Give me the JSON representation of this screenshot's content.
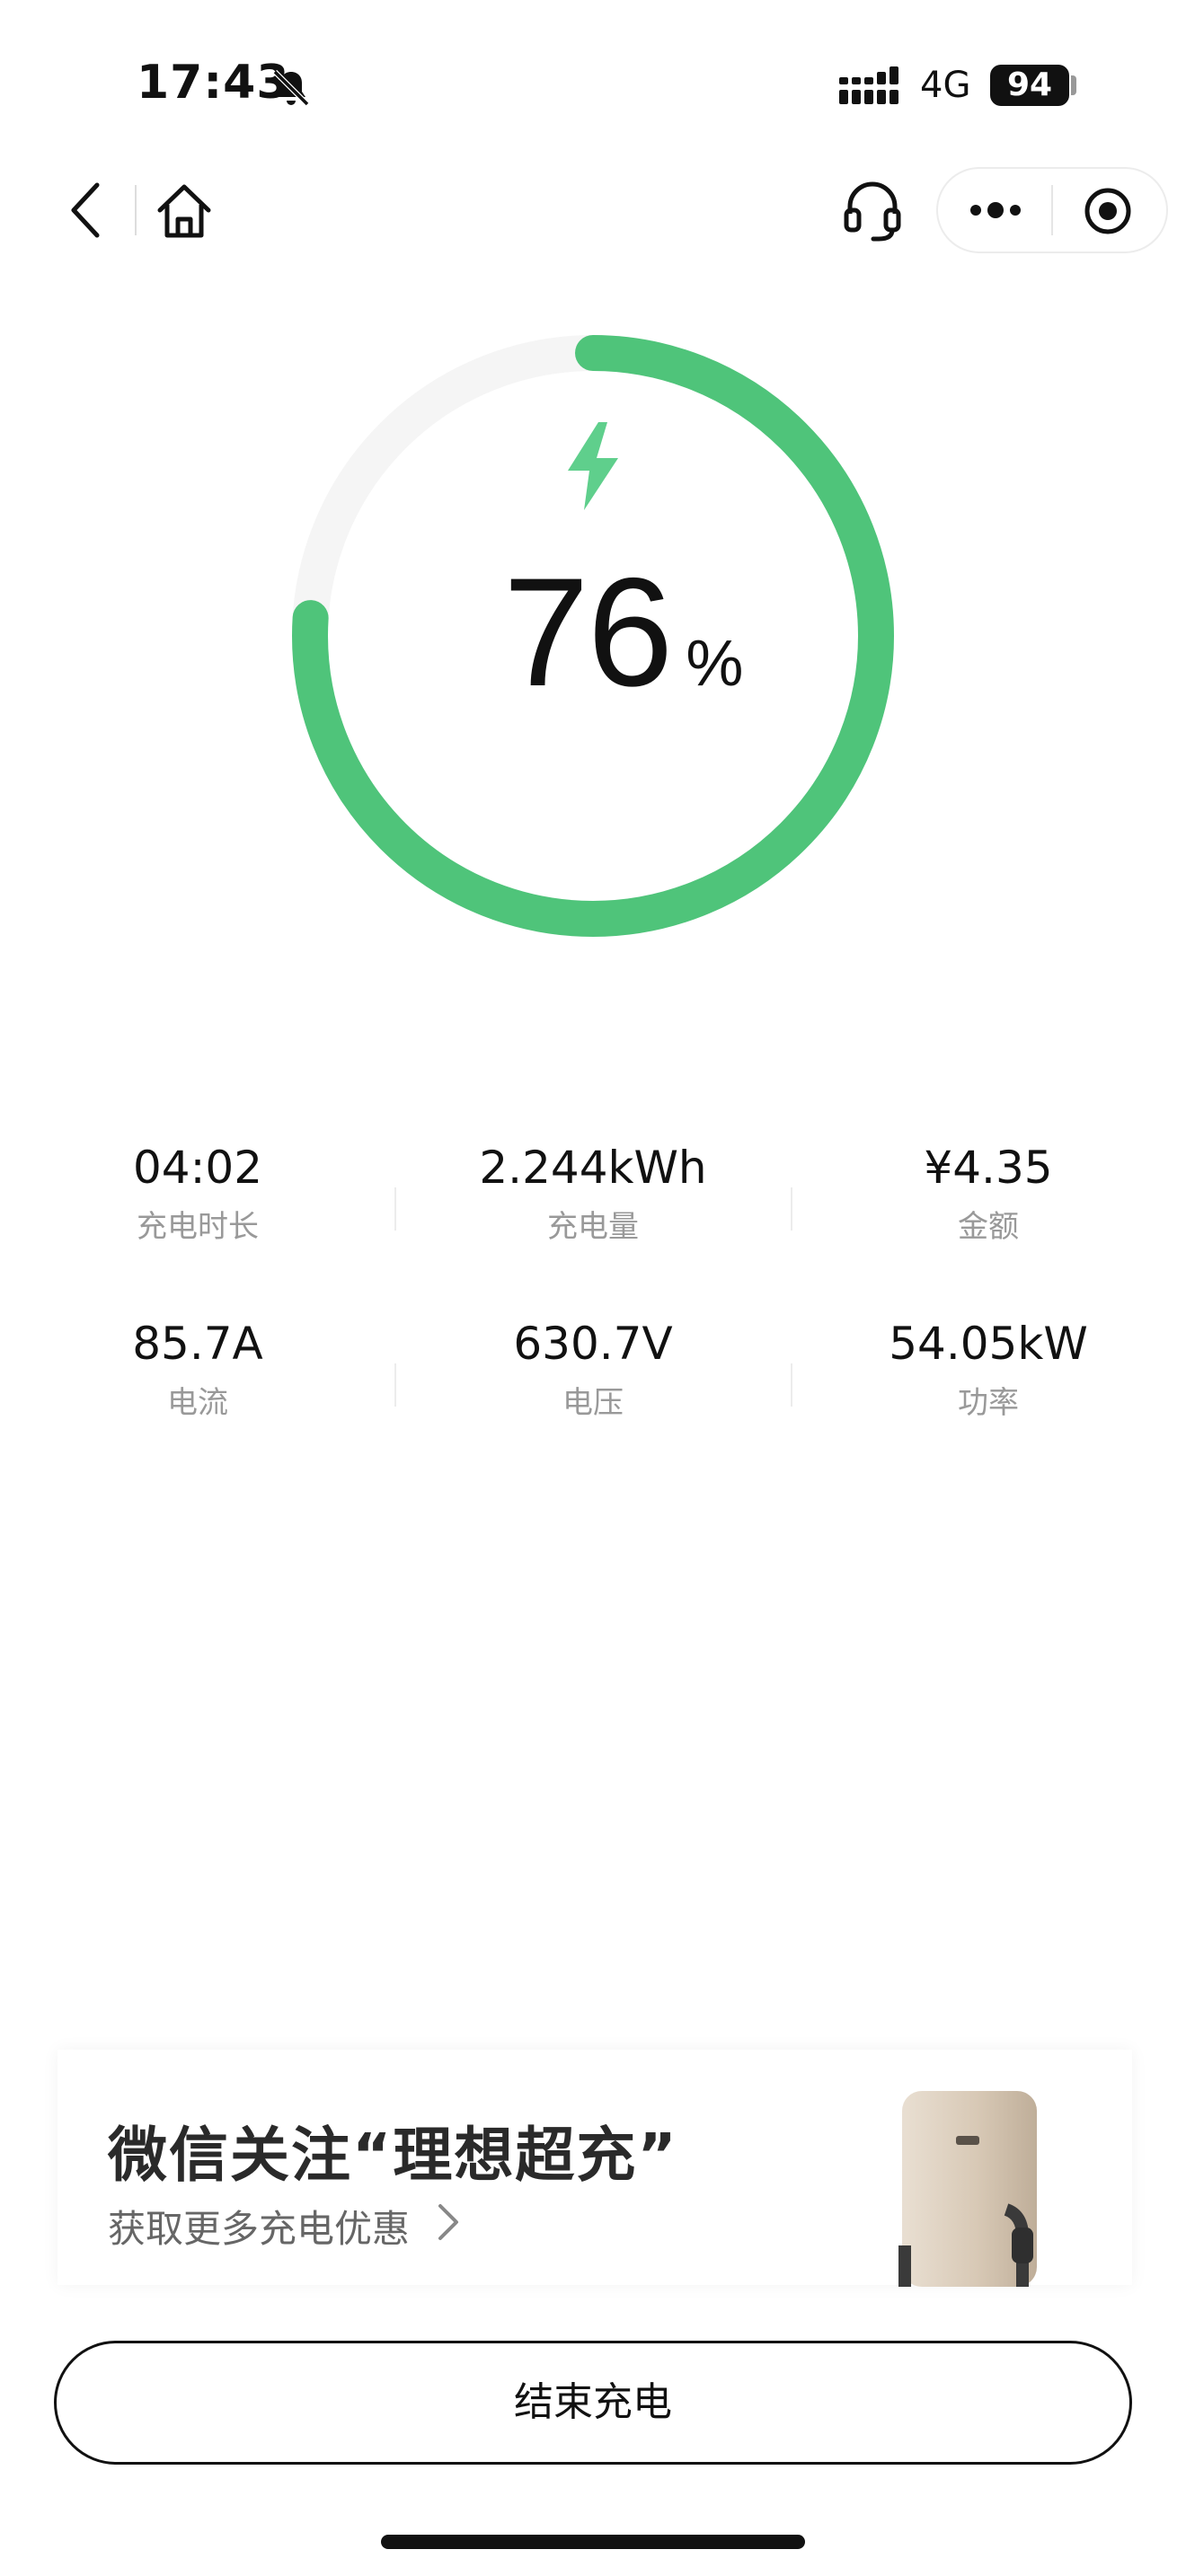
{
  "status_bar": {
    "time": "17:43",
    "network": "4G",
    "battery": "94",
    "icons": [
      "bell-slash-icon",
      "signal-icon"
    ]
  },
  "nav": {
    "icons": [
      "back-icon",
      "home-icon",
      "headset-icon",
      "more-icon",
      "target-icon"
    ]
  },
  "charging": {
    "percent": "76",
    "percent_sign": "%",
    "progress": 0.76,
    "ring_color": "#4fc47a",
    "track_color": "#f5f5f5"
  },
  "stats": [
    {
      "value": "04:02",
      "label": "充电时长"
    },
    {
      "value": "2.244kWh",
      "label": "充电量"
    },
    {
      "value": "¥4.35",
      "label": "金额"
    },
    {
      "value": "85.7A",
      "label": "电流"
    },
    {
      "value": "630.7V",
      "label": "电压"
    },
    {
      "value": "54.05kW",
      "label": "功率"
    }
  ],
  "promo": {
    "title": "微信关注“理想超充”",
    "subtitle": "获取更多充电优惠"
  },
  "end_button": "结束充电"
}
